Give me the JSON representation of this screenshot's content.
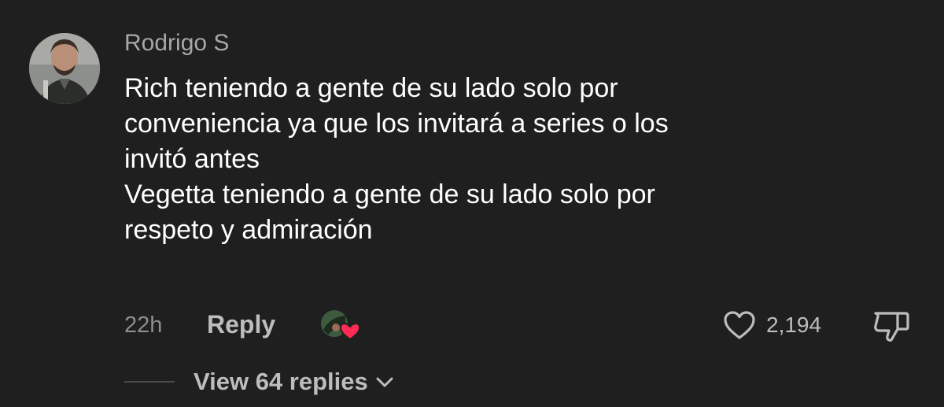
{
  "comment": {
    "author": "Rodrigo S",
    "lines": [
      "Rich teniendo a gente de su lado solo por",
      "conveniencia ya que los invitará a series o los",
      "invitó antes",
      "Vegetta teniendo a gente de su lado solo por",
      "respeto y admiración"
    ],
    "time": "22h",
    "reply_label": "Reply",
    "like_count": "2,194",
    "view_replies_label": "View 64 replies"
  },
  "colors": {
    "background": "#1f1f1f",
    "username": "#a7a7a7",
    "text": "#ffffff",
    "muted": "#8e8e8e",
    "heart_badge": "#fe2c55"
  },
  "icons": {
    "avatar": "user-avatar",
    "creator_liked": "creator-liked-badge",
    "like": "heart-outline-icon",
    "dislike": "thumbs-down-icon",
    "expand": "chevron-down-icon"
  }
}
